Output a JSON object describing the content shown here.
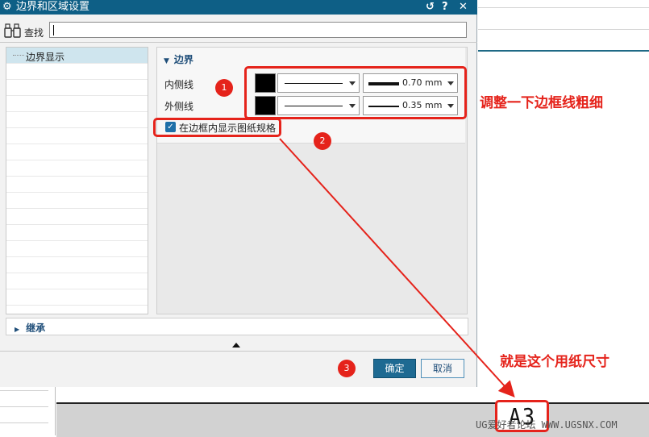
{
  "dialog": {
    "title": "边界和区域设置",
    "title_icon": "gear-icon",
    "title_buttons": {
      "reset": "↺",
      "help": "?",
      "close": "✕"
    },
    "find_label": "查找",
    "find_value": "",
    "tree_items": [
      "边界显示"
    ],
    "border_group": {
      "header": "边界",
      "inner_label": "内侧线",
      "outer_label": "外侧线",
      "inner_color": "#000000",
      "outer_color": "#000000",
      "inner_width": "0.70 mm",
      "outer_width": "0.35 mm",
      "show_sheet_size_label": "在边框内显示图纸规格",
      "show_sheet_size_checked": true
    },
    "inherit_header": "继承",
    "ok_label": "确定",
    "cancel_label": "取消"
  },
  "annotations": {
    "badge1": "1",
    "badge2": "2",
    "badge3": "3",
    "note_border": "调整一下边框线粗细",
    "note_sheet": "就是这个用纸尺寸",
    "color": "#e5231b"
  },
  "background": {
    "sheet_size_text": "A3",
    "watermark": "UG爱好者论坛 WWW.UGSNX.COM"
  }
}
